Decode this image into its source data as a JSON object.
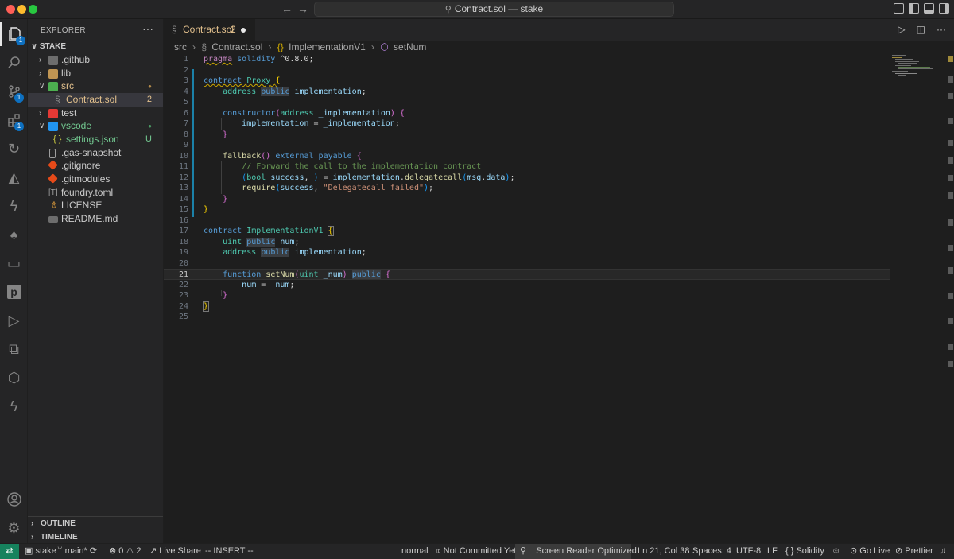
{
  "window": {
    "title": "Contract.sol — stake"
  },
  "explorer": {
    "title": "EXPLORER",
    "more": "···",
    "root": "STAKE",
    "items": [
      {
        "label": ".github",
        "decoration": "",
        "kind": "folder"
      },
      {
        "label": "lib",
        "decoration": "",
        "kind": "folder"
      },
      {
        "label": "src",
        "decoration": "●",
        "kind": "folder-open"
      },
      {
        "label": "Contract.sol",
        "decoration": "2",
        "kind": "file"
      },
      {
        "label": "test",
        "decoration": "",
        "kind": "folder"
      },
      {
        "label": "vscode",
        "decoration": "●",
        "kind": "folder-open"
      },
      {
        "label": "settings.json",
        "decoration": "U",
        "kind": "file"
      },
      {
        "label": ".gas-snapshot",
        "decoration": "",
        "kind": "file"
      },
      {
        "label": ".gitignore",
        "decoration": "",
        "kind": "file"
      },
      {
        "label": ".gitmodules",
        "decoration": "",
        "kind": "file"
      },
      {
        "label": "foundry.toml",
        "decoration": "",
        "kind": "file"
      },
      {
        "label": "LICENSE",
        "decoration": "",
        "kind": "file"
      },
      {
        "label": "README.md",
        "decoration": "",
        "kind": "file"
      }
    ],
    "outline": "OUTLINE",
    "timeline": "TIMELINE"
  },
  "activity_badges": {
    "explorer": "1",
    "scm": "1",
    "extensions": "1"
  },
  "tab": {
    "name": "Contract.sol",
    "problems": "2"
  },
  "breadcrumb": {
    "folder": "src",
    "file": "Contract.sol",
    "contract": "ImplementationV1",
    "function": "setNum"
  },
  "editor": {
    "current_line": "21",
    "line_numbers": [
      "1",
      "2",
      "3",
      "4",
      "5",
      "6",
      "7",
      "8",
      "9",
      "10",
      "11",
      "12",
      "13",
      "14",
      "15",
      "16",
      "17",
      "18",
      "19",
      "20",
      "21",
      "22",
      "23",
      "24",
      "25"
    ]
  },
  "status": {
    "branch_repo": "stake",
    "branch": "main*",
    "errors": "0",
    "warnings": "2",
    "live_share": "Live Share",
    "mode": "-- INSERT --",
    "vim": "normal",
    "commit": "Not Committed Yet",
    "screen_reader": "Screen Reader Optimized",
    "cursor": "Ln 21, Col 38",
    "spaces": "Spaces: 4",
    "encoding": "UTF-8",
    "eol": "LF",
    "language": "Solidity",
    "go_live": "Go Live",
    "prettier": "Prettier"
  },
  "colors": {
    "accent": "#0e70c0",
    "remote": "#16825d",
    "modified": "#e2c08d"
  }
}
